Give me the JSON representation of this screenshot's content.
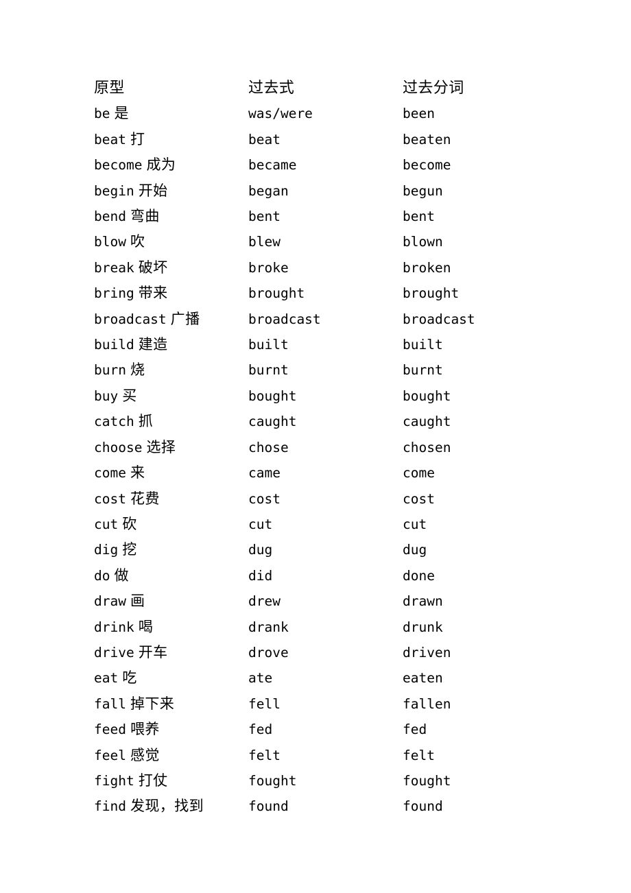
{
  "document": {
    "type": "irregular-verb-table",
    "background_color": "#ffffff",
    "text_color": "#000000"
  },
  "table": {
    "headers": {
      "base": "原型",
      "past": "过去式",
      "participle": "过去分词"
    },
    "rows": [
      {
        "en": "be",
        "zh": "是",
        "past": "was/were",
        "participle": "been"
      },
      {
        "en": "beat",
        "zh": "打",
        "past": "beat",
        "participle": "beaten"
      },
      {
        "en": "become",
        "zh": "成为",
        "past": "became",
        "participle": "become"
      },
      {
        "en": "begin",
        "zh": "开始",
        "past": "began",
        "participle": "begun"
      },
      {
        "en": "bend",
        "zh": "弯曲",
        "past": "bent",
        "participle": "bent"
      },
      {
        "en": "blow",
        "zh": "吹",
        "past": "blew",
        "participle": "blown"
      },
      {
        "en": "break",
        "zh": "破坏",
        "past": "broke",
        "participle": "broken"
      },
      {
        "en": "bring",
        "zh": "带来",
        "past": "brought",
        "participle": "brought"
      },
      {
        "en": "broadcast",
        "zh": "广播",
        "past": "broadcast",
        "participle": "broadcast"
      },
      {
        "en": "build",
        "zh": "建造",
        "past": "built",
        "participle": "built"
      },
      {
        "en": "burn",
        "zh": "烧",
        "past": "burnt",
        "participle": "burnt"
      },
      {
        "en": "buy",
        "zh": "买",
        "past": "bought",
        "participle": "bought"
      },
      {
        "en": "catch",
        "zh": "抓",
        "past": "caught",
        "participle": "caught"
      },
      {
        "en": "choose",
        "zh": "选择",
        "past": "chose",
        "participle": "chosen"
      },
      {
        "en": "come",
        "zh": "来",
        "past": "came",
        "participle": "come"
      },
      {
        "en": "cost",
        "zh": "花费",
        "past": "cost",
        "participle": "cost"
      },
      {
        "en": "cut",
        "zh": "砍",
        "past": "cut",
        "participle": "cut"
      },
      {
        "en": "dig",
        "zh": "挖",
        "past": "dug",
        "participle": "dug"
      },
      {
        "en": "do",
        "zh": "做",
        "past": "did",
        "participle": "done"
      },
      {
        "en": "draw",
        "zh": "画",
        "past": "drew",
        "participle": "drawn"
      },
      {
        "en": "drink",
        "zh": "喝",
        "past": "drank",
        "participle": "drunk"
      },
      {
        "en": "drive",
        "zh": "开车",
        "past": "drove",
        "participle": "driven"
      },
      {
        "en": "eat",
        "zh": "吃",
        "past": "ate",
        "participle": "eaten"
      },
      {
        "en": "fall",
        "zh": "掉下来",
        "past": "fell",
        "participle": "fallen"
      },
      {
        "en": "feed",
        "zh": "喂养",
        "past": "fed",
        "participle": "fed"
      },
      {
        "en": "feel",
        "zh": "感觉",
        "past": "felt",
        "participle": "felt"
      },
      {
        "en": "fight",
        "zh": "打仗",
        "past": "fought",
        "participle": "fought"
      },
      {
        "en": "find",
        "zh": "发现，找到",
        "past": "found",
        "participle": "found"
      }
    ]
  }
}
